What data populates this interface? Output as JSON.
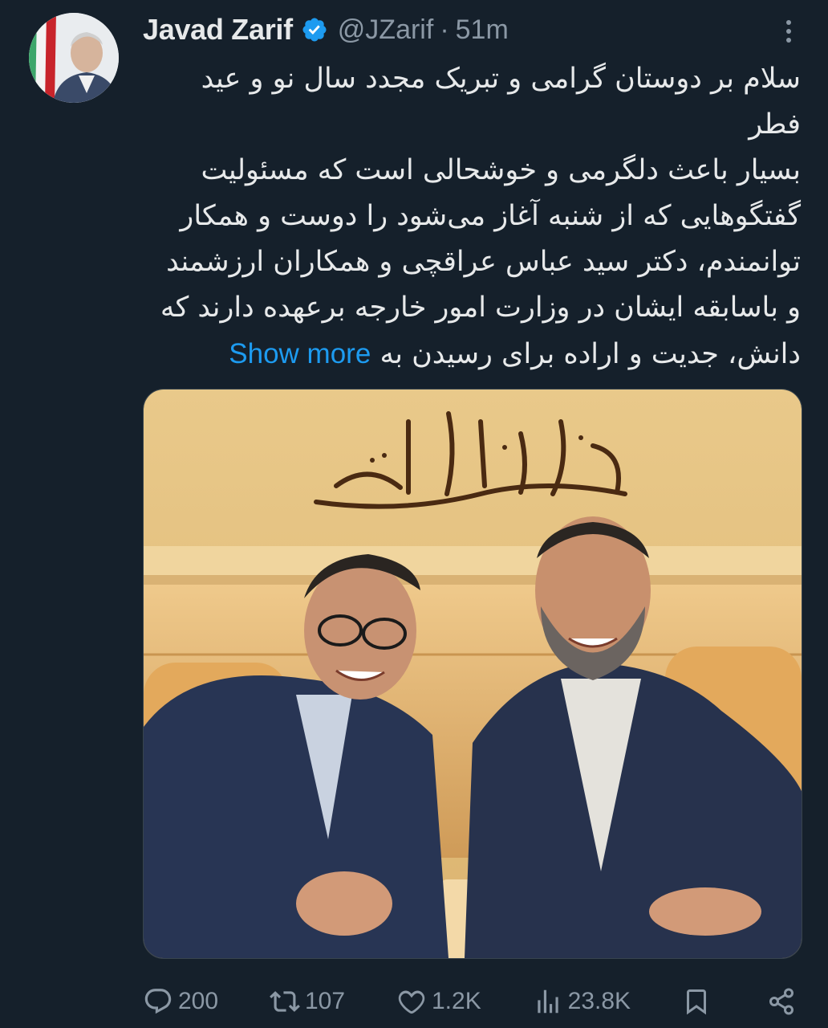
{
  "author": {
    "name": "Javad Zarif",
    "handle": "@JZarif",
    "separator": "·",
    "time": "51m"
  },
  "tweet": {
    "lines": [
      "سلام بر دوستان گرامی و تبریک مجدد سال نو و عید",
      "فطر",
      "بسیار باعث دلگرمی و خوشحالی است که مسئولیت",
      "گفتگوهایی که از شنبه آغاز می‌شود را دوست و همکار",
      "توانمندم، دکتر سید عباس عراقچی و همکاران ارزشمند",
      "و باسابقه ایشان در وزارت امور خارجه برعهده دارند که"
    ],
    "last_line": "دانش، جدیت و اراده برای رسیدن به",
    "show_more": "Show more"
  },
  "actions": {
    "replies": "200",
    "retweets": "107",
    "likes": "1.2K",
    "views": "23.8K"
  },
  "colors": {
    "background": "#15202b",
    "text": "#e7e9ea",
    "muted": "#8b98a5",
    "link": "#1d9bf0",
    "verified": "#1d9bf0"
  },
  "icons": [
    "verified-badge-icon",
    "more-options-icon",
    "reply-icon",
    "retweet-icon",
    "like-icon",
    "views-icon",
    "bookmark-icon",
    "share-icon"
  ]
}
